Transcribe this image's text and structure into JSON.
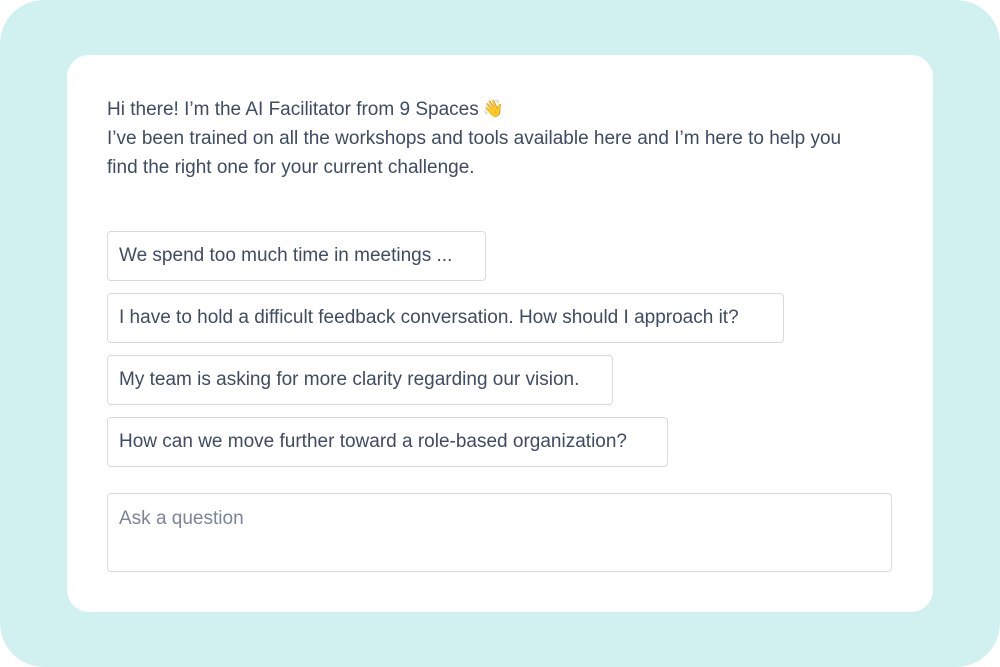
{
  "intro": {
    "greeting": "Hi there! I’m the AI Facilitator from 9 Spaces",
    "greeting_icon": "waving-hand-icon",
    "line2": "I’ve been trained on all the workshops and tools available here and I’m here to help you",
    "line3": "find the right one for your current challenge."
  },
  "suggestions": [
    {
      "label": "We spend too much time in meetings ..."
    },
    {
      "label": "I have to hold a difficult feedback conversation. How should I approach it?"
    },
    {
      "label": "My team is asking for more clarity regarding our vision."
    },
    {
      "label": "How can we move further toward a role-based organization?"
    }
  ],
  "ask": {
    "value": "",
    "placeholder": "Ask a question"
  },
  "colors": {
    "background": "#d1f1f1",
    "card": "#ffffff",
    "text": "#3f4b63",
    "border": "#d6dae1",
    "placeholder": "#7b8598"
  }
}
